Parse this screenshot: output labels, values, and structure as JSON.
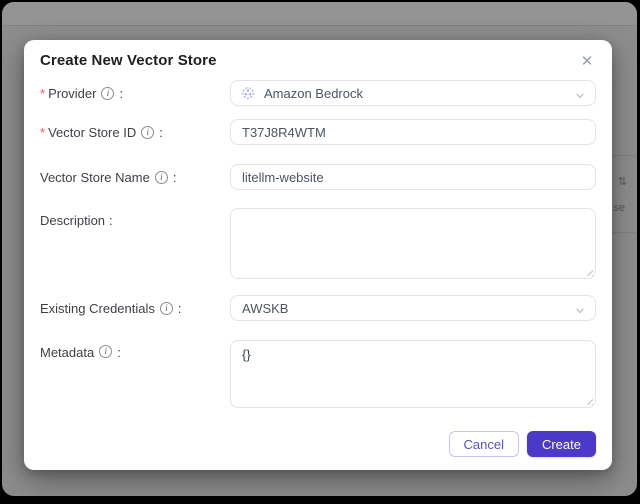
{
  "background": {
    "sort_icon_glyph": "⇅",
    "truncated_text": "se"
  },
  "modal": {
    "title": "Create New Vector Store",
    "required_marker": "*",
    "label_colon": ":",
    "fields": {
      "provider": {
        "label": "Provider",
        "value": "Amazon Bedrock",
        "required": true
      },
      "vector_store_id": {
        "label": "Vector Store ID",
        "value": "T37J8R4WTM",
        "required": true
      },
      "vector_store_name": {
        "label": "Vector Store Name",
        "value": "litellm-website"
      },
      "description": {
        "label": "Description",
        "value": ""
      },
      "existing_credentials": {
        "label": "Existing Credentials",
        "value": "AWSKB"
      },
      "metadata": {
        "label": "Metadata",
        "value": "{}"
      }
    },
    "buttons": {
      "cancel": "Cancel",
      "create": "Create"
    }
  },
  "icons": {
    "info": "i",
    "close": "✕"
  },
  "colors": {
    "primary": "#4b39c9",
    "primary_light_border": "#c9c4f2",
    "required_red": "#ff4d4f",
    "overlay_gray": "#8d8d8d",
    "input_border": "#e2e4e9"
  }
}
